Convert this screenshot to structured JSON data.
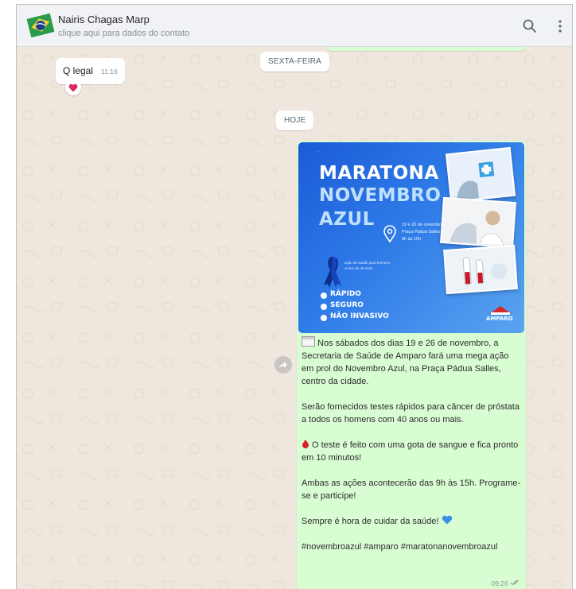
{
  "header": {
    "contact_name": "Nairis Chagas Marp",
    "contact_subtitle": "clique aqui para dados do contato"
  },
  "dividers": {
    "friday": "SEXTA-FEIRA",
    "today": "HOJE"
  },
  "incoming_message": {
    "text": "Q legal",
    "time": "11:16",
    "reaction": "heart-emoji"
  },
  "outgoing_message": {
    "poster": {
      "small_text": "...",
      "line1": "MARATONA",
      "line2": "NOVEMBRO",
      "line3": "AZUL",
      "date_text": "19 e 26 de novembro Praça Pádua Salles das 9h às 15h",
      "desc_text": "ação de saúde para homens acima de 40 anos",
      "bullet1": "RÁPIDO",
      "bullet2": "SEGURO",
      "bullet3": "NÃO INVASIVO",
      "logo": "AMPARO"
    },
    "p1": "Nos sábados dos dias 19 e 26 de novembro, a Secretaria de Saúde de Amparo fará uma mega ação em prol do Novembro Azul, na Praça Pádua Salles, centro da cidade.",
    "p2": "Serão fornecidos testes rápidos para câncer de próstata a todos os homens com 40 anos ou mais.",
    "p3": "O teste é feito com uma gota de sangue e fica pronto em 10 minutos!",
    "p4": "Ambas as ações acontecerão das 9h às 15h. Programe-se e participe!",
    "p5": "Sempre é hora de cuidar da saúde!",
    "p6": "#novembroazul #amparo #maratonanovembroazul",
    "time": "09:26"
  },
  "colors": {
    "outgoing_bubble": "#d9fdd3",
    "chat_background": "#efe7dd",
    "poster_blue": "#1b5bd6"
  }
}
